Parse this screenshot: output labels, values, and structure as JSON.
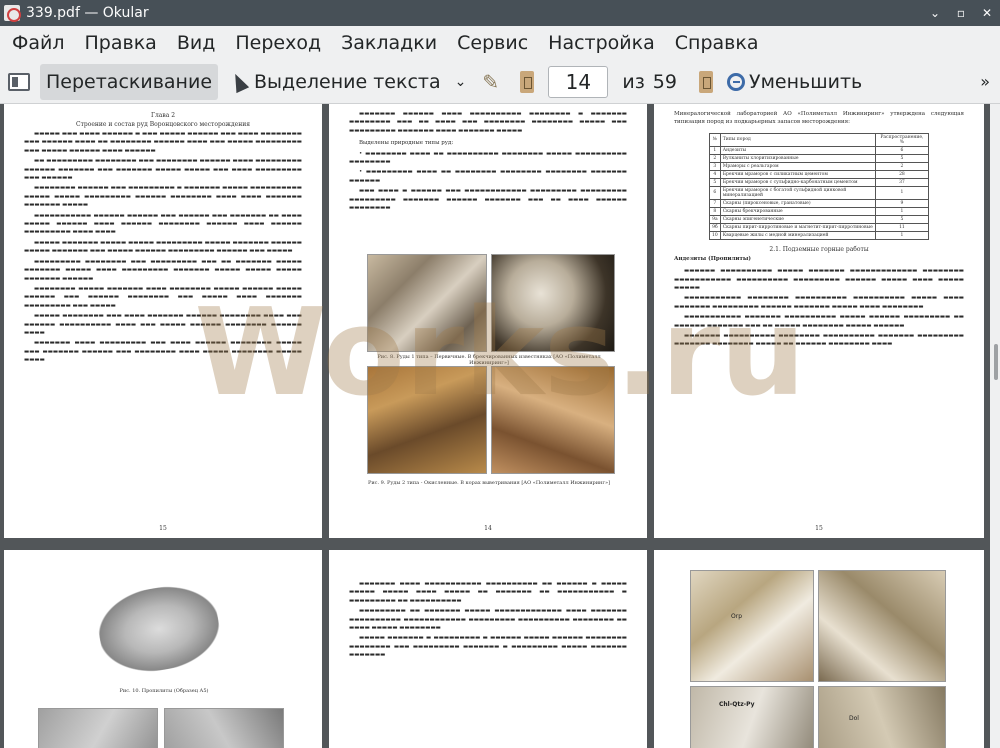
{
  "window": {
    "title": "339.pdf  — Okular",
    "controls": [
      "⌄",
      "▫",
      "✕"
    ]
  },
  "menu": [
    "Файл",
    "Правка",
    "Вид",
    "Переход",
    "Закладки",
    "Сервис",
    "Настройка",
    "Справка"
  ],
  "toolbar": {
    "browse_label": "Перетаскивание",
    "select_label": "Выделение текста",
    "page_current": "14",
    "page_of_label": "из",
    "page_total": "59",
    "zoom_out_label": "Уменьшить",
    "more": "»"
  },
  "pages": {
    "p15": {
      "heading1": "Глава 2",
      "heading2": "Строение и состав руд Воронцовского месторождения",
      "number": "15"
    },
    "p14": {
      "list_title": "Выделены природные типы руд:",
      "caption1": "Рис. 8. Руды 1 типа – Первичные. В брекчированных известняках [АО «Полиметалл Инжиниринг»]",
      "caption2": "Рис. 9. Руды 2 типа - Окисленные. В корах выветривания [АО «Полиметалл Инжиниринг»]",
      "number": "14"
    },
    "p16": {
      "intro": "Минералогической лабораторией АО «Полиметалл Инжиниринг» утверждена следующая типизация пород из подкарьерных запасов месторождения:",
      "table_header": [
        "№",
        "Типы пород",
        "Распространение, %"
      ],
      "table_rows": [
        [
          "1",
          "Андезиты",
          "6"
        ],
        [
          "2",
          "Вулканиты хлоритизированные",
          "5"
        ],
        [
          "3",
          "Мраморы с реальгаром",
          "2"
        ],
        [
          "4",
          "Брекчии мраморов с силикатным цементом",
          "28"
        ],
        [
          "5",
          "Брекчии мраморов с сульфидно-карбонатным цементом",
          "37"
        ],
        [
          "6",
          "Брекчии мраморов с богатой сульфидной цинковой минерализацией",
          "1"
        ],
        [
          "7",
          "Скарны (пироксеновые, гранатовые)",
          "9"
        ],
        [
          "8",
          "Скарны брекчированные",
          "1"
        ],
        [
          "9а",
          "Скарны эпигенетические",
          "5"
        ],
        [
          "9б",
          "Скарны пирит-пирротиновые и магнетит-пирит-пирротиновые",
          "11"
        ],
        [
          "10",
          "Кварцевые жилы с медной минерализацией",
          "1"
        ]
      ],
      "section": "2.1. Подземные горные работы",
      "subsection": "Андезиты (Пропилиты)",
      "number": "15"
    },
    "p17": {
      "caption": "Рис. 10. Пропилиты (Образец А5)"
    },
    "p19": {
      "label1": "Orp",
      "label2": "Chl-Qtz-Py",
      "label3": "Dol"
    }
  },
  "watermark": "Works.ru"
}
